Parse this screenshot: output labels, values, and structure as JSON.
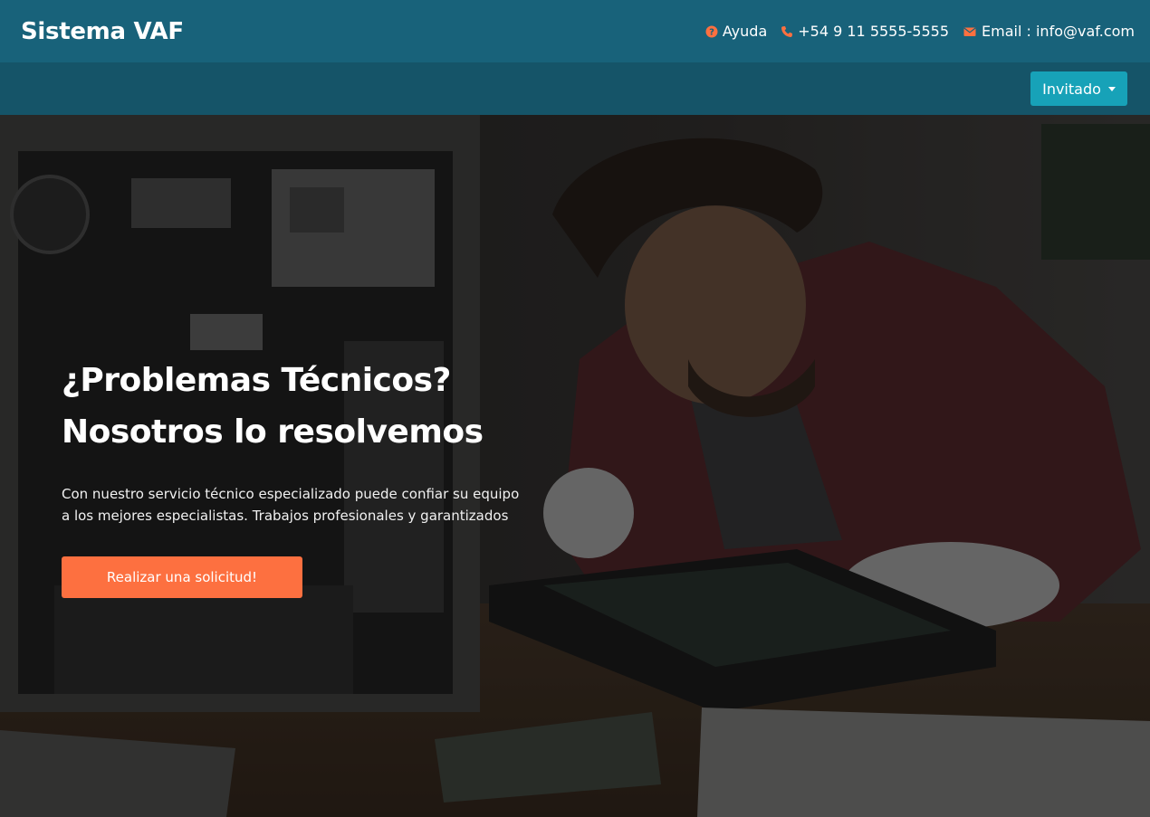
{
  "header": {
    "brand": "Sistema VAF",
    "help_label": "Ayuda",
    "phone": "+54 9 11 5555-5555",
    "email": "Email : info@vaf.com"
  },
  "nav": {
    "user_menu_label": "Invitado"
  },
  "hero": {
    "title_line1": "¿Problemas Técnicos?",
    "title_line2": "Nosotros lo resolvemos",
    "text_line1": "Con nuestro servicio técnico especializado puede confiar su equipo",
    "text_line2": "a los mejores especialistas. Trabajos profesionales y garantizados",
    "cta_label": "Realizar una solicitud!"
  },
  "colors": {
    "header_bg": "#18627a",
    "subbar_bg": "#155468",
    "accent": "#fd7040",
    "dropdown_bg": "#17a2b8"
  },
  "icons": [
    "question-circle-icon",
    "phone-icon",
    "envelope-icon",
    "caret-down-icon"
  ]
}
